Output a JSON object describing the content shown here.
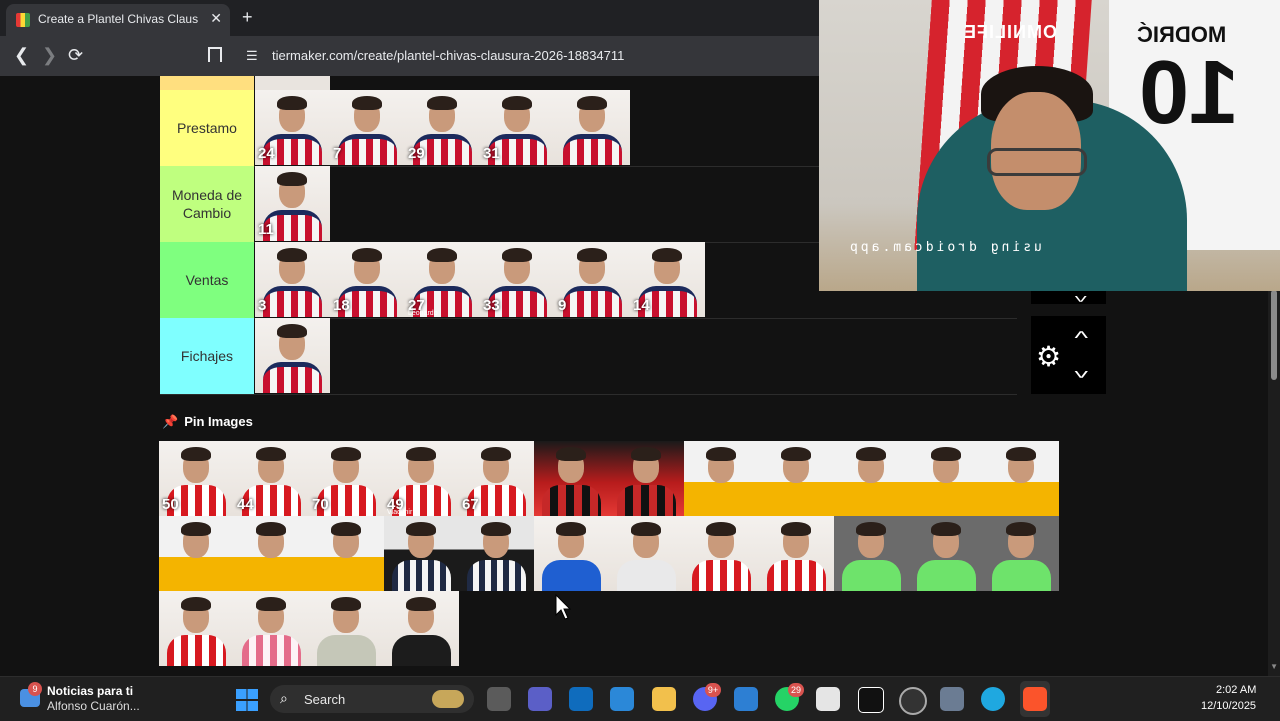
{
  "browser": {
    "tab_title": "Create a Plantel Chivas Clausura",
    "tab_close": "✕",
    "new_tab": "+",
    "url": "tiermaker.com/create/plantel-chivas-clausura-2026-18834711"
  },
  "tiers": [
    {
      "label": "Prestamo",
      "color": "#ffff7f",
      "players": [
        {
          "number": "24",
          "sub": ""
        },
        {
          "number": "7",
          "sub": ""
        },
        {
          "number": "29",
          "sub": ""
        },
        {
          "number": "31",
          "sub": ""
        },
        {
          "number": "",
          "sub": ""
        }
      ]
    },
    {
      "label": "Moneda de Cambio",
      "color": "#bfff7f",
      "players": [
        {
          "number": "11",
          "sub": ""
        }
      ]
    },
    {
      "label": "Ventas",
      "color": "#7fff7f",
      "players": [
        {
          "number": "3",
          "sub": ""
        },
        {
          "number": "18",
          "sub": ""
        },
        {
          "number": "27",
          "sub": "Leonardo"
        },
        {
          "number": "33",
          "sub": ""
        },
        {
          "number": "9",
          "sub": ""
        },
        {
          "number": "14",
          "sub": ""
        }
      ]
    },
    {
      "label": "Fichajes",
      "color": "#7fffff",
      "players": [
        {
          "number": "",
          "sub": ""
        }
      ]
    }
  ],
  "pin_images": {
    "title": "Pin Images",
    "items": [
      {
        "number": "50",
        "sub": "",
        "kit": "chivas"
      },
      {
        "number": "44",
        "sub": "",
        "kit": "chivas"
      },
      {
        "number": "70",
        "sub": "",
        "kit": "chivas"
      },
      {
        "number": "49",
        "sub": "Vladimir",
        "kit": "chivas"
      },
      {
        "number": "67",
        "sub": "",
        "kit": "chivas"
      },
      {
        "number": "",
        "sub": "",
        "kit": "atlas"
      },
      {
        "number": "",
        "sub": "",
        "kit": "atlas"
      },
      {
        "number": "",
        "sub": "",
        "kit": "tigres"
      },
      {
        "number": "",
        "sub": "",
        "kit": "tigres"
      },
      {
        "number": "",
        "sub": "",
        "kit": "tigres"
      },
      {
        "number": "",
        "sub": "",
        "kit": "tigres"
      },
      {
        "number": "",
        "sub": "",
        "kit": "tigres"
      },
      {
        "number": "",
        "sub": "",
        "kit": "tigres"
      },
      {
        "number": "",
        "sub": "",
        "kit": "tigres"
      },
      {
        "number": "",
        "sub": "",
        "kit": "tigres"
      },
      {
        "number": "",
        "sub": "",
        "kit": "rayados"
      },
      {
        "number": "",
        "sub": "",
        "kit": "rayados"
      },
      {
        "number": "",
        "sub": "",
        "kit": "cruzazul"
      },
      {
        "number": "",
        "sub": "",
        "kit": "gray"
      },
      {
        "number": "",
        "sub": "",
        "kit": "chivas"
      },
      {
        "number": "",
        "sub": "",
        "kit": "chivas"
      },
      {
        "number": "",
        "sub": "",
        "kit": "green"
      },
      {
        "number": "",
        "sub": "",
        "kit": "green"
      },
      {
        "number": "",
        "sub": "",
        "kit": "green"
      },
      {
        "number": "",
        "sub": "",
        "kit": "chivas"
      },
      {
        "number": "",
        "sub": "",
        "kit": "pink"
      },
      {
        "number": "",
        "sub": "",
        "kit": "tan"
      },
      {
        "number": "",
        "sub": "",
        "kit": "black"
      }
    ]
  },
  "webcam": {
    "watermark": "using droidcam.app",
    "jersey_left_text": "OMNILIFE",
    "jersey_right_name": "MODRIĆ",
    "jersey_right_number": "10"
  },
  "taskbar": {
    "news_badge": "9",
    "news_title": "Noticias para ti",
    "news_subtitle": "Alfonso Cuarón...",
    "search_label": "Search",
    "discord_badge": "9+",
    "whatsapp_badge": "29",
    "time": "2:02 AM",
    "date": "12/10/2025"
  },
  "icons": {
    "back": "chevron-left",
    "forward": "chevron-right",
    "reload": "reload",
    "bookmark": "bookmark",
    "settings": "gear",
    "pin": "pushpin"
  }
}
